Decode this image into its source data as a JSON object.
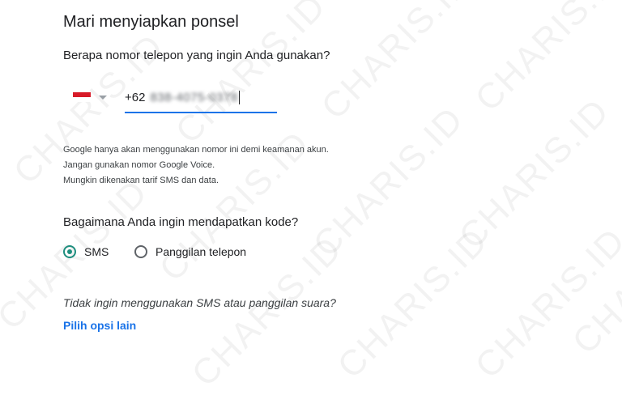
{
  "page": {
    "title": "Mari menyiapkan ponsel",
    "phone_question": "Berapa nomor telepon yang ingin Anda gunakan?"
  },
  "phone": {
    "dial_code": "+62",
    "number": "838-4075-0378"
  },
  "info": {
    "line1": "Google hanya akan menggunakan nomor ini demi keamanan akun.",
    "line2": "Jangan gunakan nomor Google Voice.",
    "line3": "Mungkin dikenakan tarif SMS dan data."
  },
  "verification": {
    "question": "Bagaimana Anda ingin mendapatkan kode?",
    "options": [
      {
        "label": "SMS",
        "selected": true
      },
      {
        "label": "Panggilan telepon",
        "selected": false
      }
    ]
  },
  "alternative": {
    "question": "Tidak ingin menggunakan SMS atau panggilan suara?",
    "link": "Pilih opsi lain"
  },
  "watermark": {
    "text": "CHARIS.ID"
  },
  "colors": {
    "accent_blue": "#1a73e8",
    "radio_teal": "#1e8e7e",
    "flag_red": "#d71a28"
  }
}
